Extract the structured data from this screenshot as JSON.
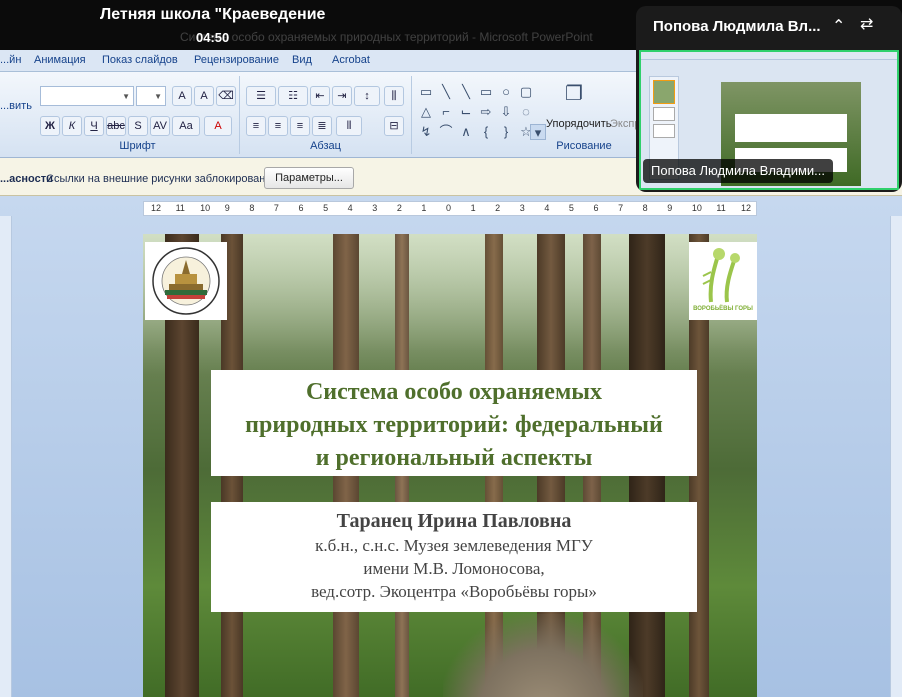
{
  "meeting": {
    "title": "Летняя школа \"Краеведение",
    "timer": "04:50",
    "ghost_caption": "Система особо охраняемых природных территорий - Microsoft PowerPoint"
  },
  "ribbon": {
    "tabs": [
      "...йн",
      "Анимация",
      "Показ слайдов",
      "Рецензирование",
      "Вид",
      "Acrobat"
    ],
    "left_cut_label": "...вить",
    "groups": {
      "font": "Шрифт",
      "paragraph": "Абзац",
      "drawing": "Рисование"
    },
    "arrange_label": "Упорядочить",
    "express_label": "Экспр..."
  },
  "security_bar": {
    "heading": "...асности",
    "message": "Ссылки на внешние рисунки заблокированы",
    "button": "Параметры..."
  },
  "ruler_ticks": [
    "12",
    "11",
    "10",
    "9",
    "8",
    "7",
    "6",
    "5",
    "4",
    "3",
    "2",
    "1",
    "0",
    "1",
    "2",
    "3",
    "4",
    "5",
    "6",
    "7",
    "8",
    "9",
    "10",
    "11",
    "12"
  ],
  "slide": {
    "left_logo_text": "Музей Землеведения МГУ · The Earth Science Museum",
    "right_logo_text": "ВОРОБЬЁВЫ ГОРЫ",
    "title_lines": [
      "Система особо охраняемых",
      "природных территорий: федеральный",
      "и региональный аспекты"
    ],
    "author_name": "Таранец Ирина Павловна",
    "author_lines": [
      "к.б.н., с.н.с. Музея землеведения МГУ",
      "имени М.В. Ломоносова,",
      "вед.сотр. Экоцентра «Воробьёвы горы»"
    ]
  },
  "pip": {
    "name_top": "Попова Людмила Вл...",
    "name_label": "Попова Людмила Владими...",
    "active_color": "#2fd06b"
  },
  "colors": {
    "title_green": "#4f6f2c",
    "ribbon_text": "#15428b"
  }
}
